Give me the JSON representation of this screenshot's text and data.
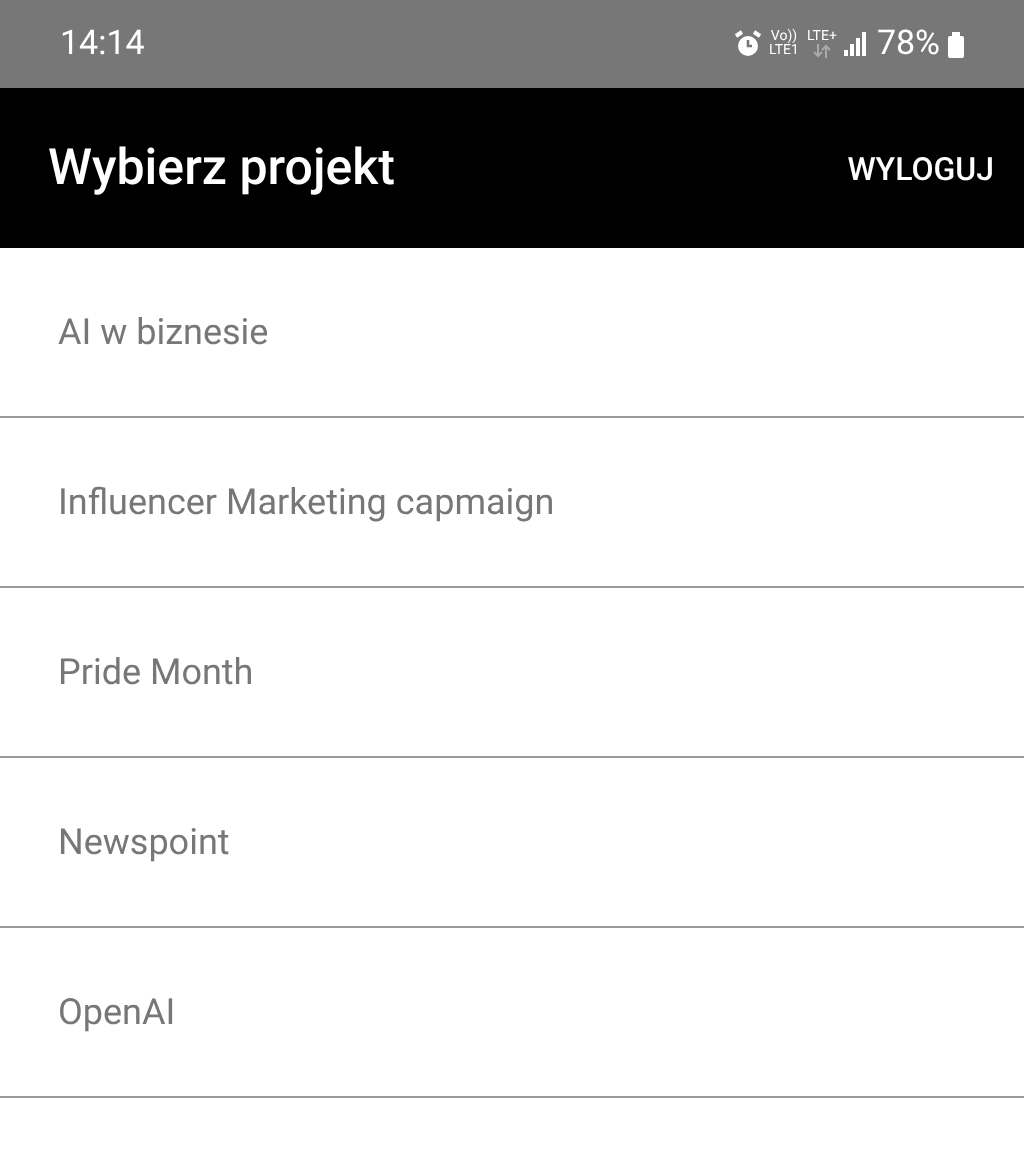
{
  "status_bar": {
    "time": "14:14",
    "volte": "Vo))",
    "lte1": "LTE1",
    "lte_plus": "LTE+",
    "battery": "78%"
  },
  "app_bar": {
    "title": "Wybierz projekt",
    "action": "WYLOGUJ"
  },
  "projects": [
    {
      "name": "AI w biznesie"
    },
    {
      "name": "Influencer Marketing capmaign"
    },
    {
      "name": "Pride Month"
    },
    {
      "name": "Newspoint"
    },
    {
      "name": "OpenAI"
    }
  ]
}
